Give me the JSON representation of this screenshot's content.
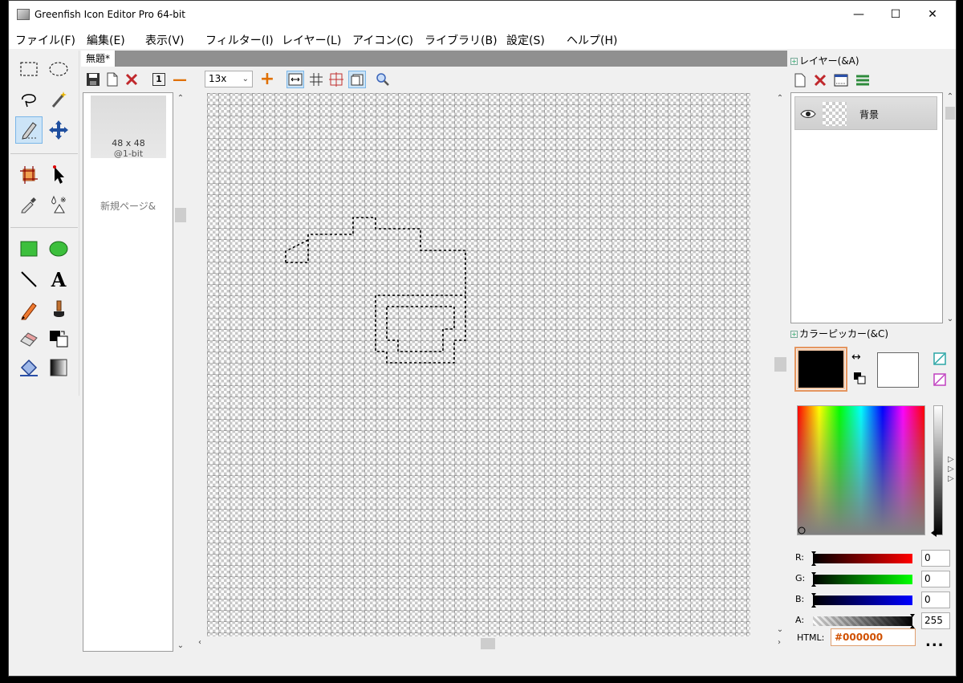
{
  "window": {
    "title": "Greenfish Icon Editor Pro 64-bit",
    "controls": {
      "minimize": "—",
      "maximize": "☐",
      "close": "✕"
    }
  },
  "menu": [
    "ファイル(F)",
    "編集(E)",
    "表示(V)",
    "フィルター(I)",
    "レイヤー(L)",
    "アイコン(C)",
    "ライブラリ(B)",
    "設定(S)",
    "ヘルプ(H)"
  ],
  "toolbox": {
    "selected_tool": "freehand-selection-tool",
    "text_tool_glyph": "A"
  },
  "document": {
    "tab_label": "無題*",
    "toolbar": {
      "zoom": "13x",
      "actual_size": "1",
      "zoom_out": "—",
      "zoom_in": "+"
    }
  },
  "pages": {
    "thumb_size": "48 x 48",
    "thumb_depth": "@1-bit",
    "new_page_label": "新規ページ&"
  },
  "layers_panel": {
    "header": "レイヤー(&A)",
    "layers": [
      {
        "name": "背景",
        "visible": true
      }
    ]
  },
  "color_picker": {
    "header": "カラーピッカー(&C)",
    "foreground": "#000000",
    "background": "#FFFFFF",
    "channels": [
      {
        "label": "R:",
        "value": "0",
        "color": "#ff0000"
      },
      {
        "label": "G:",
        "value": "0",
        "color": "#00ff00"
      },
      {
        "label": "B:",
        "value": "0",
        "color": "#0000ff"
      },
      {
        "label": "A:",
        "value": "255",
        "color": "#000000"
      }
    ],
    "html_label": "HTML:",
    "html_value": "#000000",
    "more_label": "..."
  },
  "canvas": {
    "grid_cells": 48,
    "background": "transparent-checkerboard"
  }
}
